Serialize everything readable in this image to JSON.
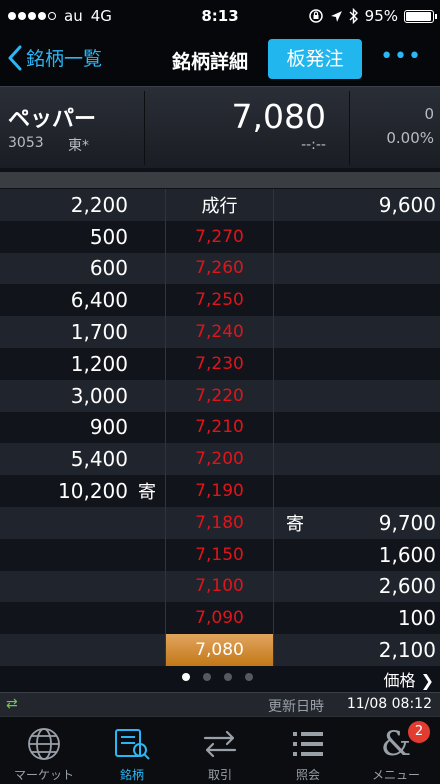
{
  "status": {
    "carrier": "au",
    "network": "4G",
    "time": "8:13",
    "battery": "95%"
  },
  "nav": {
    "back_label": "銘柄一覧",
    "title": "銘柄詳細",
    "order_button": "板発注",
    "more": "•••"
  },
  "quote": {
    "name": "ペッパー",
    "code": "3053",
    "market": "東*",
    "price": "7,080",
    "time": "--:--",
    "change": "0",
    "change_pct": "0.00%"
  },
  "board": {
    "rows": [
      {
        "sell": "2,200",
        "sell_tag": "",
        "price": "成行",
        "buy_tag": "",
        "buy": "9,600"
      },
      {
        "sell": "500",
        "sell_tag": "",
        "price": "7,270",
        "buy_tag": "",
        "buy": ""
      },
      {
        "sell": "600",
        "sell_tag": "",
        "price": "7,260",
        "buy_tag": "",
        "buy": ""
      },
      {
        "sell": "6,400",
        "sell_tag": "",
        "price": "7,250",
        "buy_tag": "",
        "buy": ""
      },
      {
        "sell": "1,700",
        "sell_tag": "",
        "price": "7,240",
        "buy_tag": "",
        "buy": ""
      },
      {
        "sell": "1,200",
        "sell_tag": "",
        "price": "7,230",
        "buy_tag": "",
        "buy": ""
      },
      {
        "sell": "3,000",
        "sell_tag": "",
        "price": "7,220",
        "buy_tag": "",
        "buy": ""
      },
      {
        "sell": "900",
        "sell_tag": "",
        "price": "7,210",
        "buy_tag": "",
        "buy": ""
      },
      {
        "sell": "5,400",
        "sell_tag": "",
        "price": "7,200",
        "buy_tag": "",
        "buy": ""
      },
      {
        "sell": "10,200",
        "sell_tag": "寄",
        "price": "7,190",
        "buy_tag": "",
        "buy": ""
      },
      {
        "sell": "",
        "sell_tag": "",
        "price": "7,180",
        "buy_tag": "寄",
        "buy": "9,700"
      },
      {
        "sell": "",
        "sell_tag": "",
        "price": "7,150",
        "buy_tag": "",
        "buy": "1,600"
      },
      {
        "sell": "",
        "sell_tag": "",
        "price": "7,100",
        "buy_tag": "",
        "buy": "2,600"
      },
      {
        "sell": "",
        "sell_tag": "",
        "price": "7,090",
        "buy_tag": "",
        "buy": "100"
      },
      {
        "sell": "",
        "sell_tag": "",
        "price": "7,080",
        "buy_tag": "",
        "buy": "2,100"
      }
    ]
  },
  "pager": {
    "price_link": "価格 ❯"
  },
  "update": {
    "label": "更新日時",
    "time": "11/08 08:12"
  },
  "tabs": [
    {
      "label": "マーケット",
      "icon": "globe-icon"
    },
    {
      "label": "銘柄",
      "icon": "stock-chart-icon"
    },
    {
      "label": "取引",
      "icon": "trade-arrows-icon"
    },
    {
      "label": "照会",
      "icon": "list-icon"
    },
    {
      "label": "メニュー",
      "icon": "menu-ampersand-icon",
      "badge": "2"
    }
  ],
  "colors": {
    "accent": "#2ab7f5",
    "ask_price": "#e0151b",
    "current_price": "#d48b2f"
  }
}
